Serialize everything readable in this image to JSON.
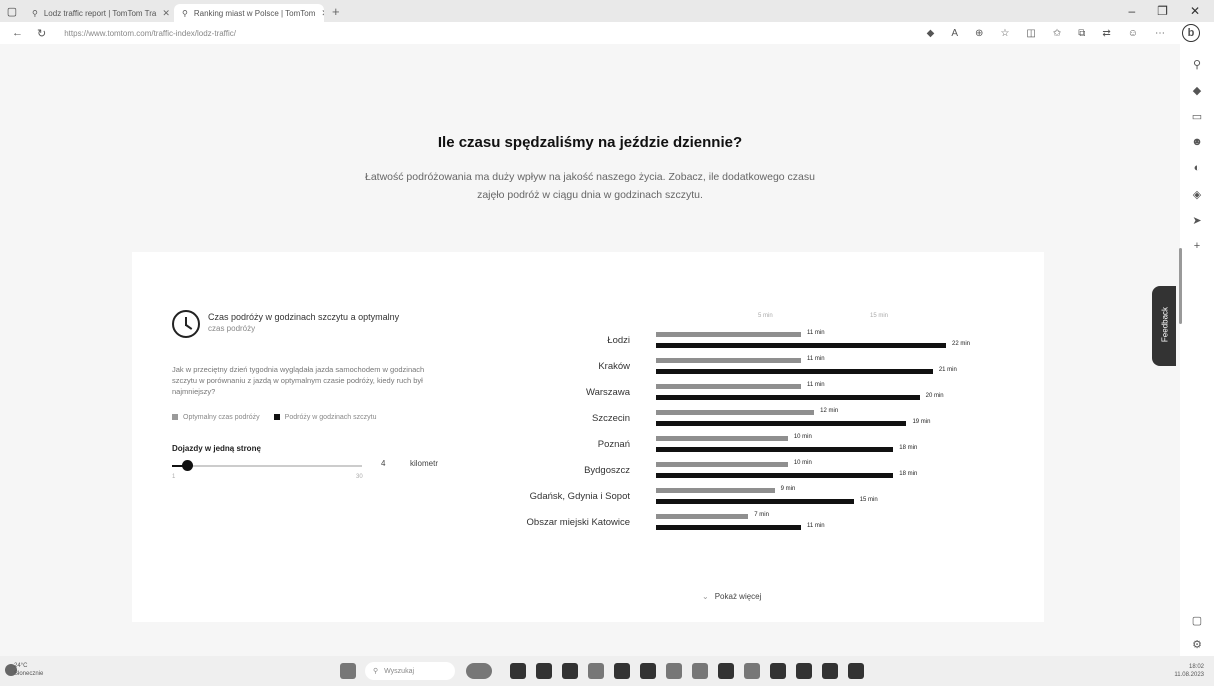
{
  "browser": {
    "tabs": [
      {
        "title": "Lodz traffic report | TomTom Tra"
      },
      {
        "title": "Ranking miast w Polsce | TomTom"
      }
    ],
    "url": "https://www.tomtom.com/traffic-index/lodz-traffic/",
    "new_tab": "+"
  },
  "page": {
    "heading": "Ile czasu spędzaliśmy na jeździe dziennie?",
    "subtitle": "Łatwość podróżowania ma duży wpływ na jakość naszego życia. Zobacz, ile dodatkowego czasu zajęło podróż w ciągu dnia w godzinach szczytu."
  },
  "card": {
    "title": "Czas podróży w godzinach szczytu a optymalny",
    "title2": "czas podróży",
    "description": "Jak w przeciętny dzień tygodnia wyglądała jazda samochodem w godzinach szczytu w porównaniu z jazdą w optymalnym czasie podróży, kiedy ruch był najmniejszy?",
    "legend_optimal": "Optymalny czas podróży",
    "legend_peak": "Podróży w godzinach szczytu",
    "commute_label": "Dojazdy w jedną stronę",
    "slider_value": "4",
    "slider_unit": "kilometr",
    "slider_min": "1",
    "slider_max": "30",
    "axis_left": "5 min",
    "axis_right": "15 min",
    "show_more": "Pokaż więcej"
  },
  "chart_data": {
    "type": "bar",
    "categories": [
      "Łodzi",
      "Kraków",
      "Warszawa",
      "Szczecin",
      "Poznań",
      "Bydgoszcz",
      "Gdańsk, Gdynia i Sopot",
      "Obszar miejski Katowice"
    ],
    "series": [
      {
        "name": "Optymalny czas podróży",
        "values": [
          11,
          11,
          11,
          12,
          10,
          10,
          9,
          7
        ]
      },
      {
        "name": "Podróży w godzinach szczytu",
        "values": [
          22,
          21,
          20,
          19,
          18,
          18,
          15,
          11
        ]
      }
    ],
    "labels_optimal": [
      "11 min",
      "11 min",
      "11 min",
      "12 min",
      "10 min",
      "10 min",
      "9 min",
      "7 min"
    ],
    "labels_peak": [
      "22 min",
      "21 min",
      "20 min",
      "19 min",
      "18 min",
      "18 min",
      "15 min",
      "11 min"
    ],
    "unit": "min",
    "colors": {
      "optimal": "#8f8f8f",
      "peak": "#111111"
    },
    "xlim": [
      0,
      22
    ]
  },
  "taskbar": {
    "weather_temp": "24°C",
    "weather_desc": "Słonecznie",
    "search_placeholder": "Wyszukaj",
    "time": "18:02",
    "date": "11.08.2023"
  },
  "sidebar": {
    "feedback": "Feedback"
  }
}
